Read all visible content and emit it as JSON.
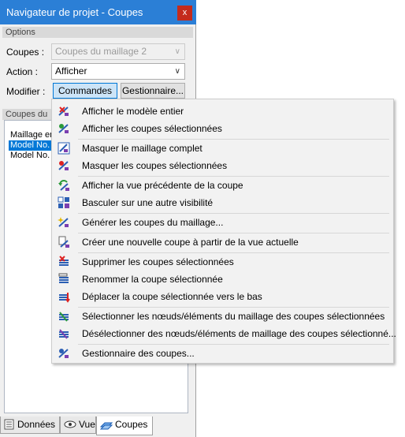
{
  "window": {
    "title": "Navigateur de projet - Coupes",
    "close_glyph": "x"
  },
  "options": {
    "header": "Options",
    "coupes": {
      "label": "Coupes :",
      "value": "Coupes du maillage 2"
    },
    "action": {
      "label": "Action :",
      "value": "Afficher"
    },
    "modifier": {
      "label": "Modifier :",
      "commandes": "Commandes",
      "gestionnaire": "Gestionnaire..."
    }
  },
  "coupes_section": {
    "header": "Coupes du m"
  },
  "tree": {
    "items": [
      "Maillage en",
      "Model No.",
      "Model No."
    ]
  },
  "tabs": [
    "Données",
    "Vue",
    "Coupes"
  ],
  "menu": {
    "items": [
      "Afficher le modèle entier",
      "Afficher les coupes sélectionnées",
      "Masquer le maillage complet",
      "Masquer les coupes sélectionnées",
      "Afficher la vue précédente de la coupe",
      "Basculer sur une autre visibilité",
      "Générer les coupes du maillage...",
      "Créer une nouvelle coupe à partir de la vue actuelle",
      "Supprimer les coupes sélectionnées",
      "Renommer la coupe sélectionnée",
      "Déplacer la coupe sélectionnée vers le bas",
      "Sélectionner les nœuds/éléments du maillage des coupes sélectionnées",
      "Désélectionner des nœuds/éléments de maillage des coupes sélectionné...",
      "Gestionnaire des coupes..."
    ]
  },
  "colors": {
    "titlebar": "#2b7fd6",
    "close": "#c42b1c",
    "selection": "#0078d7"
  }
}
